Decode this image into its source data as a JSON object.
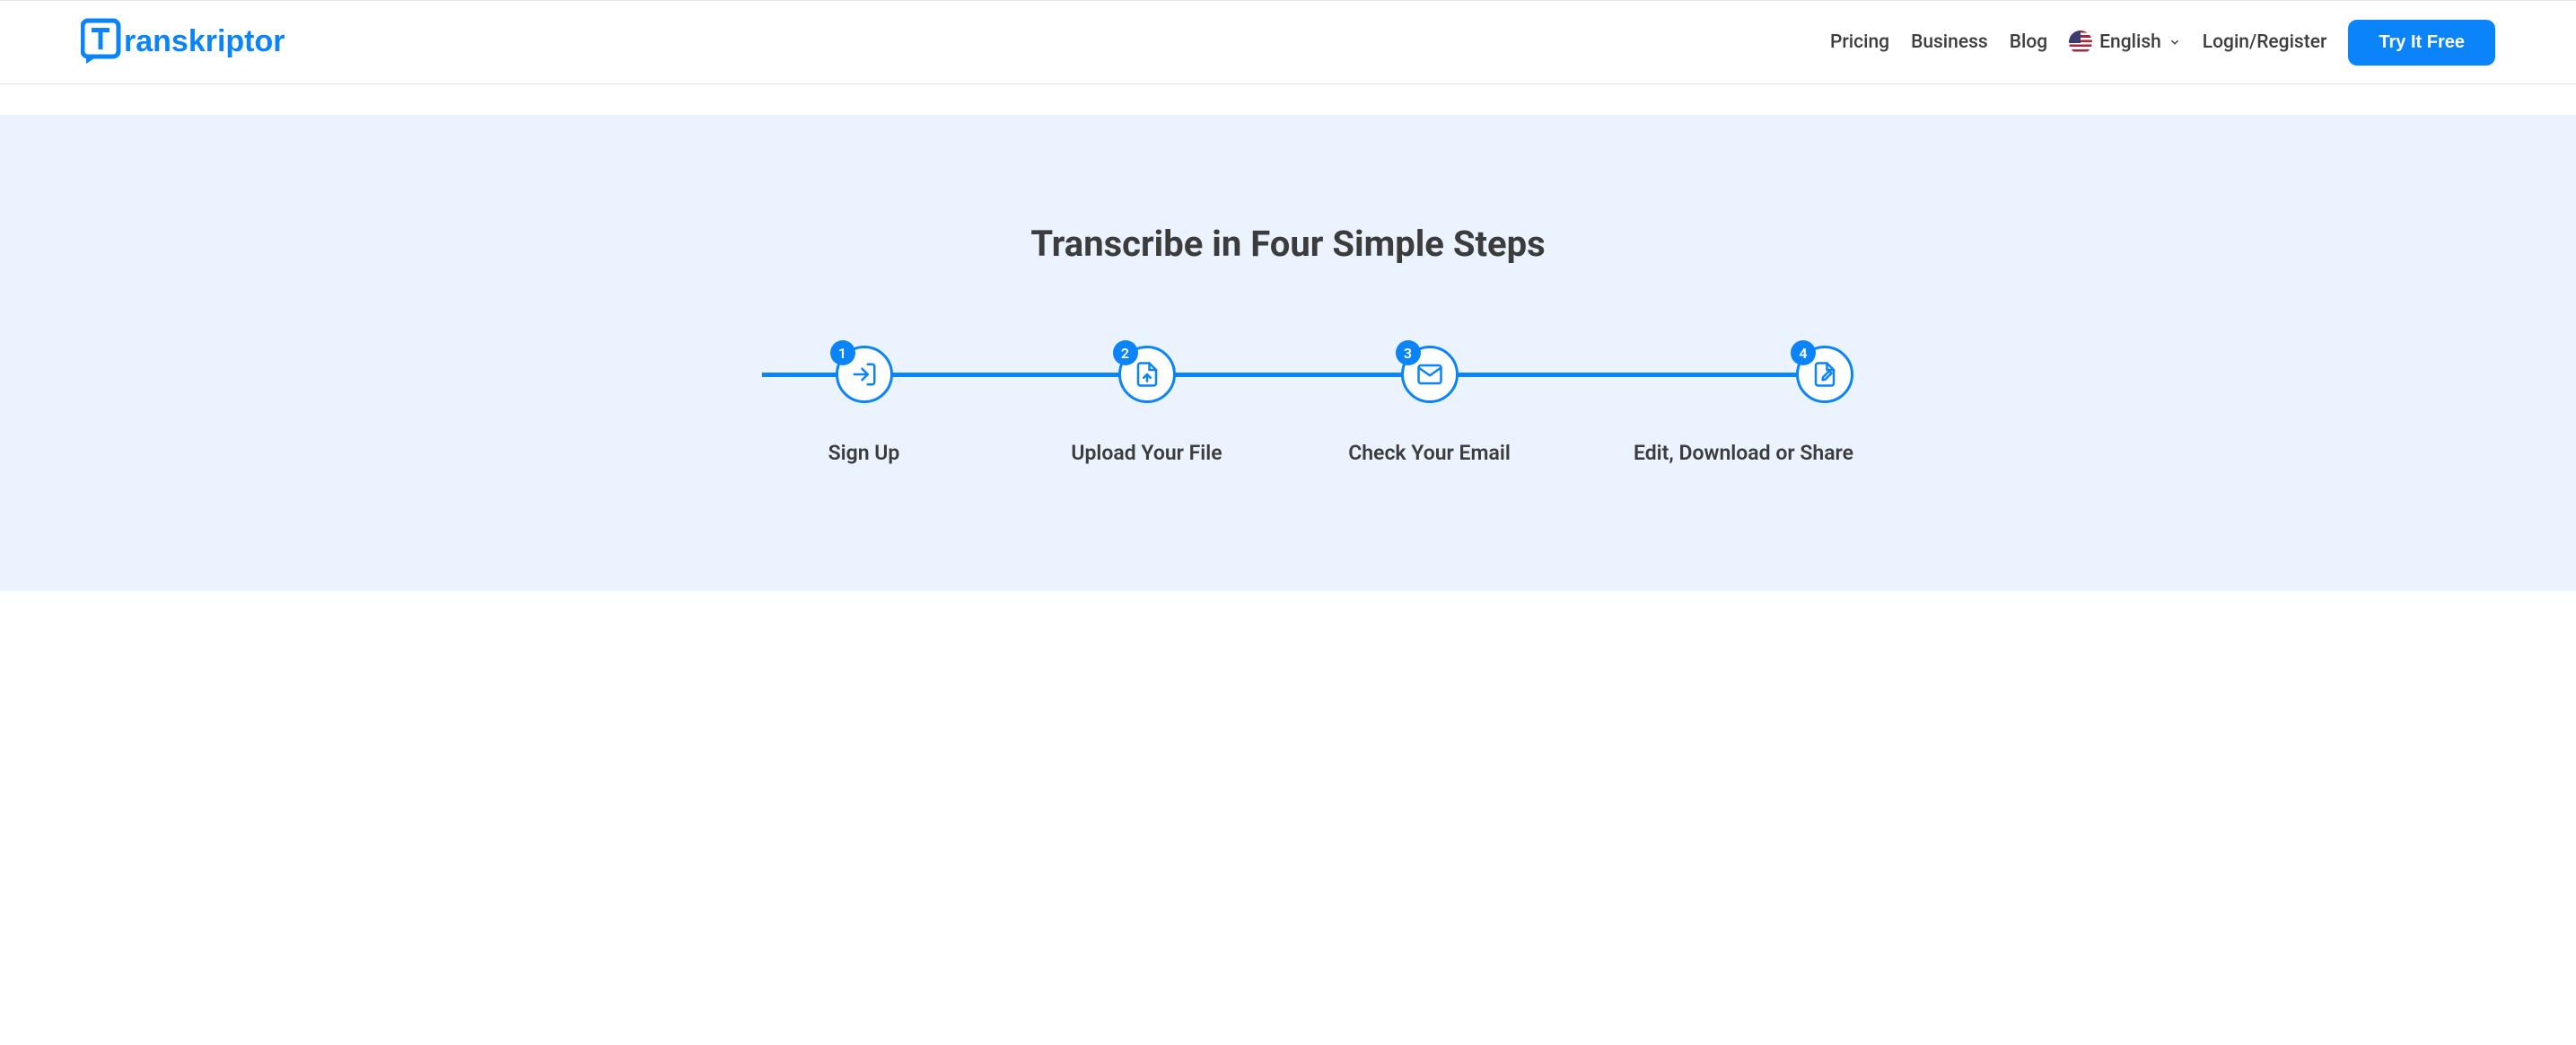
{
  "brand": {
    "name": "Transkriptor"
  },
  "nav": {
    "pricing": "Pricing",
    "business": "Business",
    "blog": "Blog",
    "language": "English",
    "login": "Login/Register",
    "cta": "Try It Free"
  },
  "hero": {
    "title": "Transcribe in Four Simple Steps",
    "steps": [
      {
        "num": "1",
        "label": "Sign Up",
        "icon": "signin-icon"
      },
      {
        "num": "2",
        "label": "Upload Your File",
        "icon": "upload-icon"
      },
      {
        "num": "3",
        "label": "Check Your Email",
        "icon": "email-icon"
      },
      {
        "num": "4",
        "label": "Edit, Download or Share",
        "icon": "edit-icon"
      }
    ]
  },
  "colors": {
    "primary": "#0b84fa",
    "text": "#3c3c3c",
    "heroBg": "#eaf3fe"
  }
}
